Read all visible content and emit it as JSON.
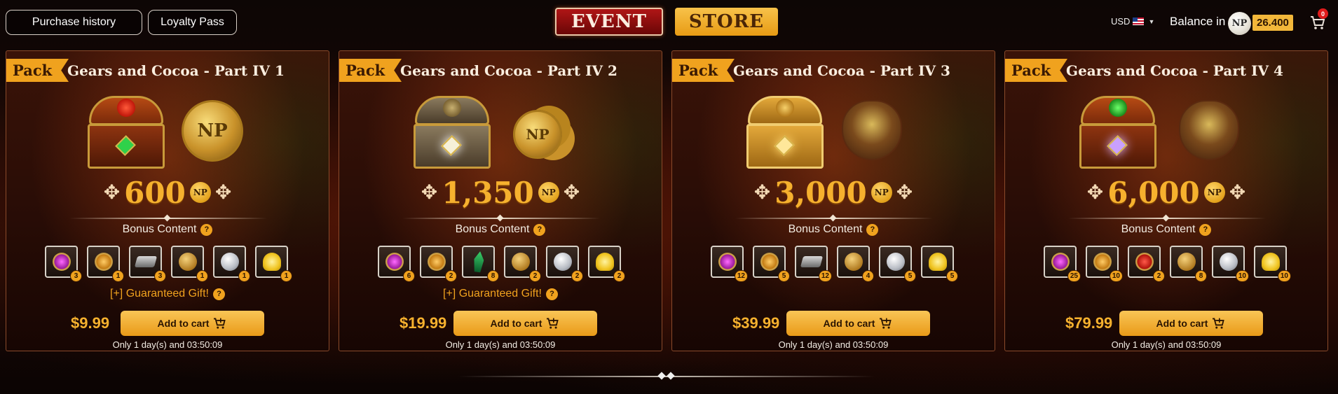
{
  "topbar": {
    "purchase_history": "Purchase history",
    "loyalty_pass": "Loyalty Pass",
    "tab_event": "EVENT",
    "tab_store": "STORE",
    "currency": "USD",
    "balance_label": "Balance in",
    "np_symbol": "NP",
    "balance_value": "26.400",
    "cart_count": "0"
  },
  "cards": [
    {
      "tag": "Pack",
      "title": "Gears and Cocoa - Part IV 1",
      "np_amount": "600",
      "np_symbol": "NP",
      "bonus_label": "Bonus Content",
      "items": [
        {
          "icon": "purple-gem-icon",
          "qty": "3"
        },
        {
          "icon": "amber-gem-icon",
          "qty": "1"
        },
        {
          "icon": "ingot-icon",
          "qty": "3"
        },
        {
          "icon": "gold-coin-icon",
          "qty": "1"
        },
        {
          "icon": "silver-coin-icon",
          "qty": "1"
        },
        {
          "icon": "ribbon-medal-icon",
          "qty": "1"
        }
      ],
      "gift": "[+] Guaranteed Gift!",
      "price": "$9.99",
      "cart_label": "Add to cart",
      "timer": "Only 1 day(s) and 03:50:09"
    },
    {
      "tag": "Pack",
      "title": "Gears and Cocoa - Part IV 2",
      "np_amount": "1,350",
      "np_symbol": "NP",
      "bonus_label": "Bonus Content",
      "items": [
        {
          "icon": "purple-gem-icon",
          "qty": "6"
        },
        {
          "icon": "amber-gem-icon",
          "qty": "2"
        },
        {
          "icon": "crystal-icon",
          "qty": "8"
        },
        {
          "icon": "gold-coin-icon",
          "qty": "2"
        },
        {
          "icon": "silver-coin-icon",
          "qty": "2"
        },
        {
          "icon": "ribbon-medal-icon",
          "qty": "2"
        }
      ],
      "gift": "[+] Guaranteed Gift!",
      "price": "$19.99",
      "cart_label": "Add to cart",
      "timer": "Only 1 day(s) and 03:50:09"
    },
    {
      "tag": "Pack",
      "title": "Gears and Cocoa - Part IV 3",
      "np_amount": "3,000",
      "np_symbol": "NP",
      "bonus_label": "Bonus Content",
      "items": [
        {
          "icon": "purple-gem-icon",
          "qty": "12"
        },
        {
          "icon": "amber-gem-icon",
          "qty": "5"
        },
        {
          "icon": "ingot-icon",
          "qty": "12"
        },
        {
          "icon": "gold-coin-icon",
          "qty": "4"
        },
        {
          "icon": "silver-coin-icon",
          "qty": "5"
        },
        {
          "icon": "ribbon-medal-icon",
          "qty": "5"
        }
      ],
      "gift": "",
      "price": "$39.99",
      "cart_label": "Add to cart",
      "timer": "Only 1 day(s) and 03:50:09"
    },
    {
      "tag": "Pack",
      "title": "Gears and Cocoa - Part IV 4",
      "np_amount": "6,000",
      "np_symbol": "NP",
      "bonus_label": "Bonus Content",
      "items": [
        {
          "icon": "purple-gem-icon",
          "qty": "25"
        },
        {
          "icon": "amber-gem-icon",
          "qty": "10"
        },
        {
          "icon": "ruby-gem-icon",
          "qty": "2"
        },
        {
          "icon": "gold-coin-icon",
          "qty": "8"
        },
        {
          "icon": "silver-coin-icon",
          "qty": "10"
        },
        {
          "icon": "ribbon-medal-icon",
          "qty": "10"
        }
      ],
      "gift": "",
      "price": "$79.99",
      "cart_label": "Add to cart",
      "timer": "Only 1 day(s) and 03:50:09"
    }
  ],
  "colors": {
    "accent_orange": "#f0a21e",
    "price_gold": "#f6b12e",
    "event_red": "#b01616"
  }
}
